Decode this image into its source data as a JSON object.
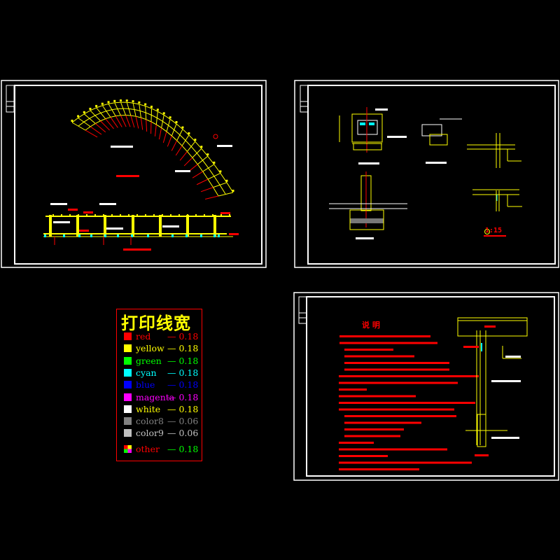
{
  "legend": {
    "title": "打印线宽",
    "items": [
      {
        "name": "red",
        "value": "0.18",
        "color": "#ff0000",
        "text_color": "#ff0000",
        "value_color": "#ff0000"
      },
      {
        "name": "yellow",
        "value": "0.18",
        "color": "#ffff00",
        "text_color": "#ffff00",
        "value_color": "#ffff00"
      },
      {
        "name": "green",
        "value": "0.18",
        "color": "#00ff00",
        "text_color": "#00ff00",
        "value_color": "#00ff00"
      },
      {
        "name": "cyan",
        "value": "0.18",
        "color": "#00ffff",
        "text_color": "#00ffff",
        "value_color": "#00ffff"
      },
      {
        "name": "blue",
        "value": "0.18",
        "color": "#0000ff",
        "text_color": "#0000ff",
        "value_color": "#0000ff"
      },
      {
        "name": "magenta",
        "value": "0.18",
        "color": "#ff00ff",
        "text_color": "#ff00ff",
        "value_color": "#ff00ff"
      },
      {
        "name": "white",
        "value": "0.18",
        "color": "#ffffff",
        "text_color": "#ffff00",
        "value_color": "#ffff00"
      },
      {
        "name": "color8",
        "value": "0.06",
        "color": "#808080",
        "text_color": "#808080",
        "value_color": "#808080"
      },
      {
        "name": "color9",
        "value": "0.06",
        "color": "#c0c0c0",
        "text_color": "#c0c0c0",
        "value_color": "#c0c0c0"
      },
      {
        "name": "other",
        "value": "0.18",
        "color": "multi",
        "text_color": "#ff0000",
        "value_color": "#00ff00"
      }
    ]
  },
  "detail_sheet": {
    "scale_label": "1:15"
  },
  "notes_sheet": {
    "title": "说    明"
  },
  "colors": {
    "background": "#000000",
    "frame": "#ffffff",
    "structure": "#ffff00",
    "annotation": "#ff0000",
    "accent": "#00ffff"
  }
}
